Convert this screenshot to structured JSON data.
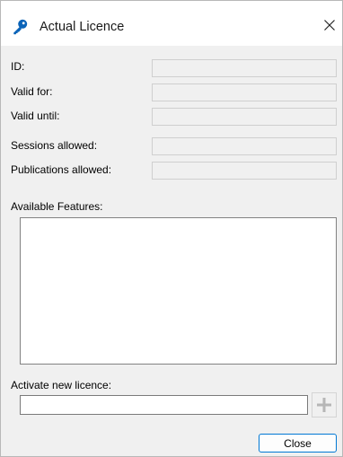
{
  "window": {
    "title": "Actual Licence",
    "title_icon": "key-icon",
    "close_icon": "close-icon"
  },
  "licence": {
    "id_label": "ID:",
    "id_value": "",
    "valid_for_label": "Valid for:",
    "valid_for_value": "",
    "valid_until_label": "Valid until:",
    "valid_until_value": "",
    "sessions_allowed_label": "Sessions allowed:",
    "sessions_allowed_value": "",
    "publications_allowed_label": "Publications allowed:",
    "publications_allowed_value": ""
  },
  "features": {
    "label": "Available Features:",
    "items": []
  },
  "activate": {
    "label": "Activate new licence:",
    "value": "",
    "add_icon": "plus-icon"
  },
  "footer": {
    "close_label": "Close"
  },
  "colors": {
    "key_icon": "#0a63b8",
    "dialog_background": "#f0f0f0",
    "focus_border": "#0078d4"
  }
}
